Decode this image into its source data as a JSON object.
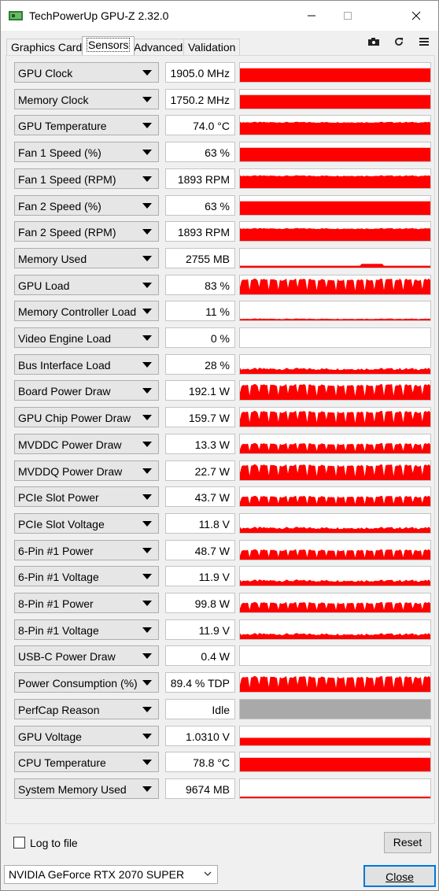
{
  "window": {
    "title": "TechPowerUp GPU-Z 2.32.0"
  },
  "tabs": [
    "Graphics Card",
    "Sensors",
    "Advanced",
    "Validation"
  ],
  "active_tab": "Sensors",
  "toolbar": {
    "icons": [
      "camera-icon",
      "refresh-icon",
      "menu-icon"
    ]
  },
  "colors": {
    "graph_red": "#ff0000",
    "graph_gray": "#a9a9a9"
  },
  "sensors": [
    {
      "name": "GPU Clock",
      "value": "1905.0 MHz",
      "graph": "flat-high"
    },
    {
      "name": "Memory Clock",
      "value": "1750.2 MHz",
      "graph": "flat-high"
    },
    {
      "name": "GPU Temperature",
      "value": "74.0 °C",
      "graph": "jagged-high"
    },
    {
      "name": "Fan 1 Speed (%)",
      "value": "63 %",
      "graph": "flat-high"
    },
    {
      "name": "Fan 1 Speed (RPM)",
      "value": "1893 RPM",
      "graph": "jagged-high"
    },
    {
      "name": "Fan 2 Speed (%)",
      "value": "63 %",
      "graph": "flat-high"
    },
    {
      "name": "Fan 2 Speed (RPM)",
      "value": "1893 RPM",
      "graph": "jagged-high"
    },
    {
      "name": "Memory Used",
      "value": "2755 MB",
      "graph": "low-line"
    },
    {
      "name": "GPU Load",
      "value": "83 %",
      "graph": "spiky"
    },
    {
      "name": "Memory Controller Load",
      "value": "11 %",
      "graph": "very-low"
    },
    {
      "name": "Video Engine Load",
      "value": "0 %",
      "graph": "empty"
    },
    {
      "name": "Bus Interface Load",
      "value": "28 %",
      "graph": "low-jagged"
    },
    {
      "name": "Board Power Draw",
      "value": "192.1 W",
      "graph": "spiky"
    },
    {
      "name": "GPU Chip Power Draw",
      "value": "159.7 W",
      "graph": "spiky"
    },
    {
      "name": "MVDDC Power Draw",
      "value": "13.3 W",
      "graph": "spiky-mid"
    },
    {
      "name": "MVDDQ Power Draw",
      "value": "22.7 W",
      "graph": "spiky"
    },
    {
      "name": "PCIe Slot Power",
      "value": "43.7 W",
      "graph": "spiky-mid"
    },
    {
      "name": "PCIe Slot Voltage",
      "value": "11.8 V",
      "graph": "low-jagged"
    },
    {
      "name": "6-Pin #1 Power",
      "value": "48.7 W",
      "graph": "spiky-mid"
    },
    {
      "name": "6-Pin #1 Voltage",
      "value": "11.9 V",
      "graph": "low-jagged"
    },
    {
      "name": "8-Pin #1 Power",
      "value": "99.8 W",
      "graph": "spiky-mid"
    },
    {
      "name": "8-Pin #1 Voltage",
      "value": "11.9 V",
      "graph": "low-jagged"
    },
    {
      "name": "USB-C Power Draw",
      "value": "0.4 W",
      "graph": "empty"
    },
    {
      "name": "Power Consumption (%)",
      "value": "89.4 % TDP",
      "graph": "spiky"
    },
    {
      "name": "PerfCap Reason",
      "value": "Idle",
      "graph": "gray-fill"
    },
    {
      "name": "GPU Voltage",
      "value": "1.0310 V",
      "graph": "mid-flat"
    },
    {
      "name": "CPU Temperature",
      "value": "78.8 °C",
      "graph": "flat-high"
    },
    {
      "name": "System Memory Used",
      "value": "9674 MB",
      "graph": "thin-line"
    }
  ],
  "footer": {
    "log_label": "Log to file",
    "log_checked": false,
    "reset_label": "Reset",
    "gpu_select": "NVIDIA GeForce RTX 2070 SUPER",
    "close_label": "Close"
  }
}
